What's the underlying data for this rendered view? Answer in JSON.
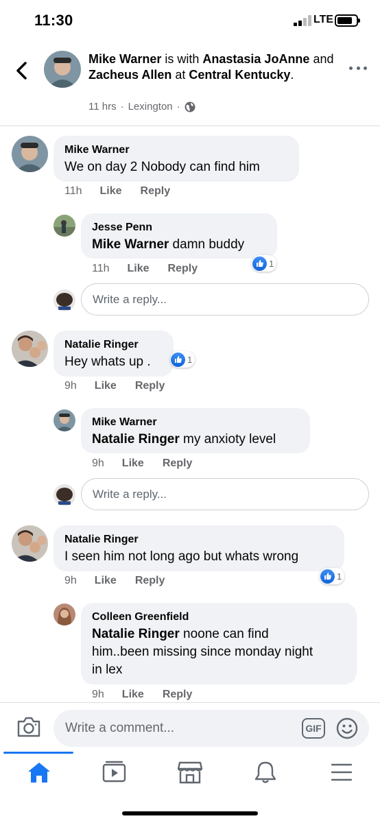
{
  "status_bar": {
    "time": "11:30",
    "network": "LTE"
  },
  "header": {
    "author": "Mike Warner",
    "with_text": " is with ",
    "tagged_1": "Anastasia JoAnne",
    "and_text": " and ",
    "tagged_2": "Zacheus Allen",
    "at_text": " at ",
    "location": "Central Kentucky",
    "period": ".",
    "time": "11 hrs",
    "place": "Lexington",
    "dot": "·"
  },
  "comments": [
    {
      "author": "Mike Warner",
      "mention": "",
      "text": "We on day 2 Nobody can find him",
      "time": "11h",
      "like": "Like",
      "reply": "Reply"
    },
    {
      "author": "Jesse Penn",
      "mention": "Mike Warner",
      "text": " damn buddy",
      "time": "11h",
      "like": "Like",
      "reply": "Reply",
      "reactions": "1"
    },
    {
      "author": "Natalie Ringer",
      "mention": "",
      "text": "Hey whats up .",
      "time": "9h",
      "like": "Like",
      "reply": "Reply",
      "reactions": "1"
    },
    {
      "author": "Mike Warner",
      "mention": "Natalie Ringer",
      "text": " my anxioty level",
      "time": "9h",
      "like": "Like",
      "reply": "Reply"
    },
    {
      "author": "Natalie Ringer",
      "mention": "",
      "text": "I seen him not long ago but whats wrong",
      "time": "9h",
      "like": "Like",
      "reply": "Reply",
      "reactions": "1"
    },
    {
      "author": "Colleen Greenfield",
      "mention": "Natalie Ringer",
      "text_line1": " noone can find",
      "text_line2": "him..been missing since monday night",
      "text_line3": "in lex",
      "time": "9h",
      "like": "Like",
      "reply": "Reply"
    }
  ],
  "reply_placeholder": "Write a reply...",
  "comment_bar": {
    "placeholder": "Write a comment...",
    "gif": "GIF"
  },
  "tabs": [
    "home-icon",
    "watch-icon",
    "marketplace-icon",
    "notifications-icon",
    "menu-icon"
  ],
  "colors": {
    "accent": "#1877f2",
    "bubble": "#f0f2f5",
    "meta": "#65676b"
  }
}
